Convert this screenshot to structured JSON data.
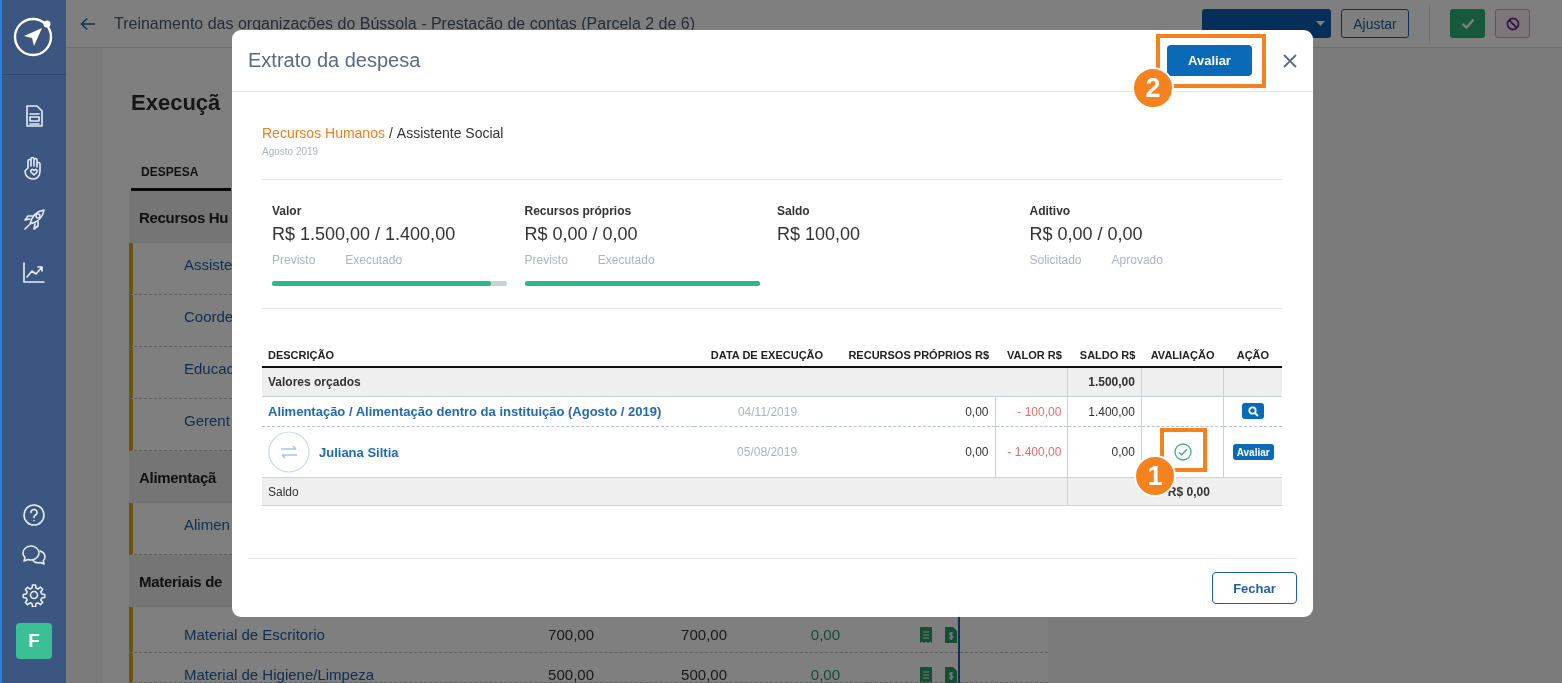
{
  "sidebar": {
    "avatar": "F"
  },
  "header": {
    "title": "Treinamento das organizações do Bússola - Prestação de contas (Parcela 2 de 6)",
    "buttons": [
      {
        "kind": "dropdown"
      },
      {
        "kind": "text",
        "label": "Ajustar"
      },
      {
        "kind": "approve"
      },
      {
        "kind": "block"
      }
    ]
  },
  "page": {
    "title": "Execuçã",
    "column": "DESPESA",
    "groups": [
      {
        "name": "Recursos Hu",
        "items": [
          {
            "name": "Assiste"
          },
          {
            "name": "Coorde"
          },
          {
            "name": "Educac"
          },
          {
            "name": "Gerent"
          }
        ]
      },
      {
        "name": "Alimentaçã",
        "items": [
          {
            "name": "Alimen"
          }
        ]
      },
      {
        "name": "Materiais de",
        "items": [
          {
            "name": "Material de Escritorio",
            "values": [
              "700,00",
              "700,00",
              "0,00"
            ]
          },
          {
            "name": "Material de Higiene/Limpeza",
            "values": [
              "500,00",
              "500,00",
              "0,00"
            ]
          }
        ]
      }
    ]
  },
  "modal": {
    "title": "Extrato da despesa",
    "primary_button": {
      "label": "Avaliar",
      "annotation": "2"
    },
    "breadcrumb": {
      "category": "Recursos Humanos",
      "separator": "/",
      "item": "Assistente Social"
    },
    "period": "Agosto 2019",
    "stats": [
      {
        "label": "Valor",
        "value": "R$ 1.500,00 / 1.400,00",
        "sublabels": [
          "Previsto",
          "Executado"
        ],
        "level": 0.93
      },
      {
        "label": "Recursos próprios",
        "value": "R$ 0,00 / 0,00",
        "sublabels": [
          "Previsto",
          "Executado"
        ],
        "level": 1
      },
      {
        "label": "Saldo",
        "value": "R$ 100,00"
      },
      {
        "label": "Aditivo",
        "value": "R$ 0,00 / 0,00",
        "sublabels": [
          "Solicitado",
          "Aprovado"
        ]
      }
    ],
    "table": {
      "columns": [
        "DESCRIÇÃO",
        "DATA DE EXECUÇÃO",
        "RECURSOS PRÓPRIOS R$",
        "VALOR R$",
        "SALDO R$",
        "AVALIAÇÃO",
        "AÇÃO"
      ],
      "rows": [
        {
          "kind": "budget",
          "description": "Valores orçados",
          "saldo": "1.500,00"
        },
        {
          "kind": "expense",
          "description": "Alimentação / Alimentação dentro da instituição (Agosto / 2019)",
          "date": "04/11/2019",
          "resources": "0,00",
          "value": "- 100,00",
          "saldo": "1.400,00",
          "evaluated": false,
          "action": {
            "kind": "view"
          }
        },
        {
          "kind": "transfer",
          "description": "Juliana Siltia",
          "date": "05/08/2019",
          "resources": "0,00",
          "value": "- 1.400,00",
          "saldo": "0,00",
          "evaluated": true,
          "annotation": "1",
          "action": {
            "kind": "button",
            "label": "Avaliar"
          }
        },
        {
          "kind": "total",
          "description": "Saldo",
          "total": "R$ 0,00"
        }
      ]
    },
    "close_button": "Fechar"
  }
}
